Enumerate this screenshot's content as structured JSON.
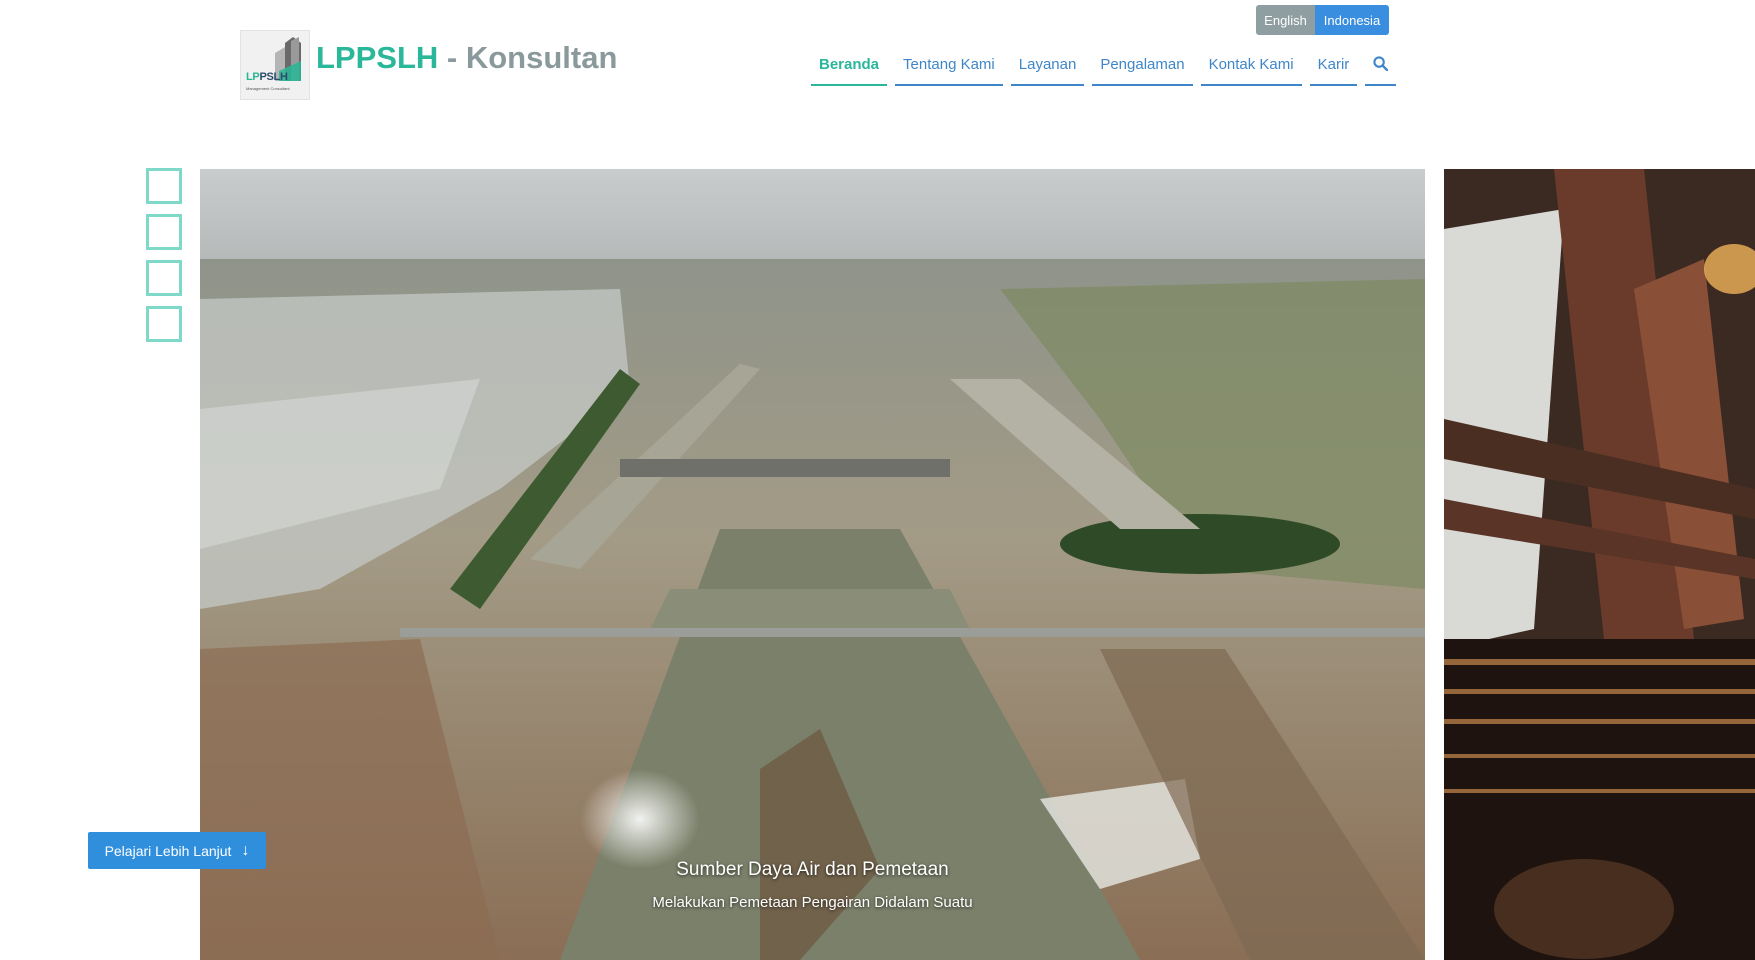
{
  "lang": {
    "english": "English",
    "indonesia": "Indonesia"
  },
  "brand": {
    "logo_lp": "LP",
    "logo_rest": "PSLH",
    "logo_sub": "Management Consultant",
    "name": "LPPSLH",
    "suffix": " - Konsultan"
  },
  "nav": {
    "items": [
      {
        "label": "Beranda",
        "active": true
      },
      {
        "label": "Tentang Kami"
      },
      {
        "label": "Layanan"
      },
      {
        "label": "Pengalaman"
      },
      {
        "label": "Kontak Kami"
      },
      {
        "label": "Karir"
      }
    ],
    "search_icon": "search-icon"
  },
  "slider": {
    "indicator_count": 4,
    "caption_title": "Sumber Daya Air dan Pemetaan",
    "caption_sub": "Melakukan Pemetaan Pengairan Didalam Suatu"
  },
  "cta": {
    "label": "Pelajari Lebih Lanjut",
    "icon": "arrow-down-icon"
  },
  "colors": {
    "accent": "#2ab79a",
    "link": "#3f86c9",
    "button": "#2f8fdc"
  }
}
